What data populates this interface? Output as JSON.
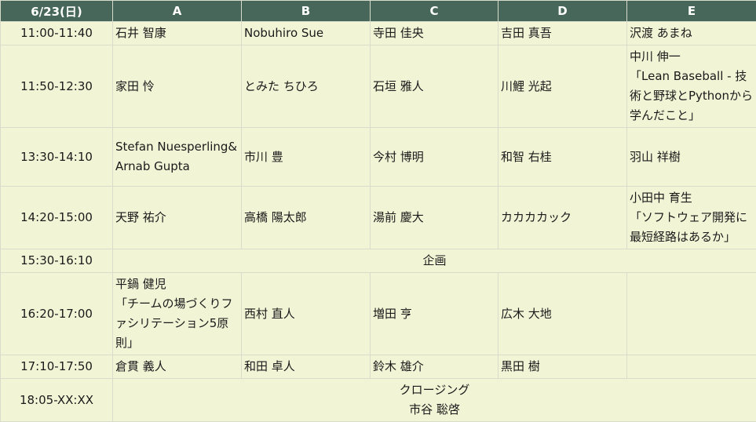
{
  "header": {
    "date": "6/23(日)",
    "columns": [
      "A",
      "B",
      "C",
      "D",
      "E"
    ]
  },
  "rows": [
    {
      "time": "11:00-11:40",
      "A": "石井 智康",
      "B": "Nobuhiro Sue",
      "C": "寺田 佳央",
      "D": "吉田 真吾",
      "E": "沢渡 あまね"
    },
    {
      "time": "11:50-12:30",
      "A": "家田 怜",
      "B": "とみた ちひろ",
      "C": "石垣 雅人",
      "D": "川鯉 光起",
      "E_name": "中川 伸一",
      "E_talk": "「Lean Baseball - 技術と野球とPythonから学んだこと」"
    },
    {
      "time": "13:30-14:10",
      "A": "Stefan Nuesperling&Arnab Gupta",
      "B": "市川 豊",
      "C": "今村 博明",
      "D": "和智 右桂",
      "E": "羽山 祥樹"
    },
    {
      "time": "14:20-15:00",
      "A": "天野 祐介",
      "B": "高橋 陽太郎",
      "C": "湯前 慶大",
      "D": "カカカカック",
      "E_name": "小田中 育生",
      "E_talk": "「ソフトウェア開発に最短経路はあるか」"
    },
    {
      "time": "15:30-16:10",
      "merged": "企画"
    },
    {
      "time": "16:20-17:00",
      "A_name": "平鍋 健児",
      "A_talk": "「チームの場づくりファシリテーション5原則」",
      "B": "西村 直人",
      "C": "増田 亨",
      "D": "広木 大地",
      "E": ""
    },
    {
      "time": "17:10-17:50",
      "A": "倉貫 義人",
      "B": "和田 卓人",
      "C": "鈴木 雄介",
      "D": "黒田 樹",
      "E": ""
    },
    {
      "time": "18:05-XX:XX",
      "merged_title": "クロージング",
      "merged_name": "市谷 聡啓"
    }
  ]
}
